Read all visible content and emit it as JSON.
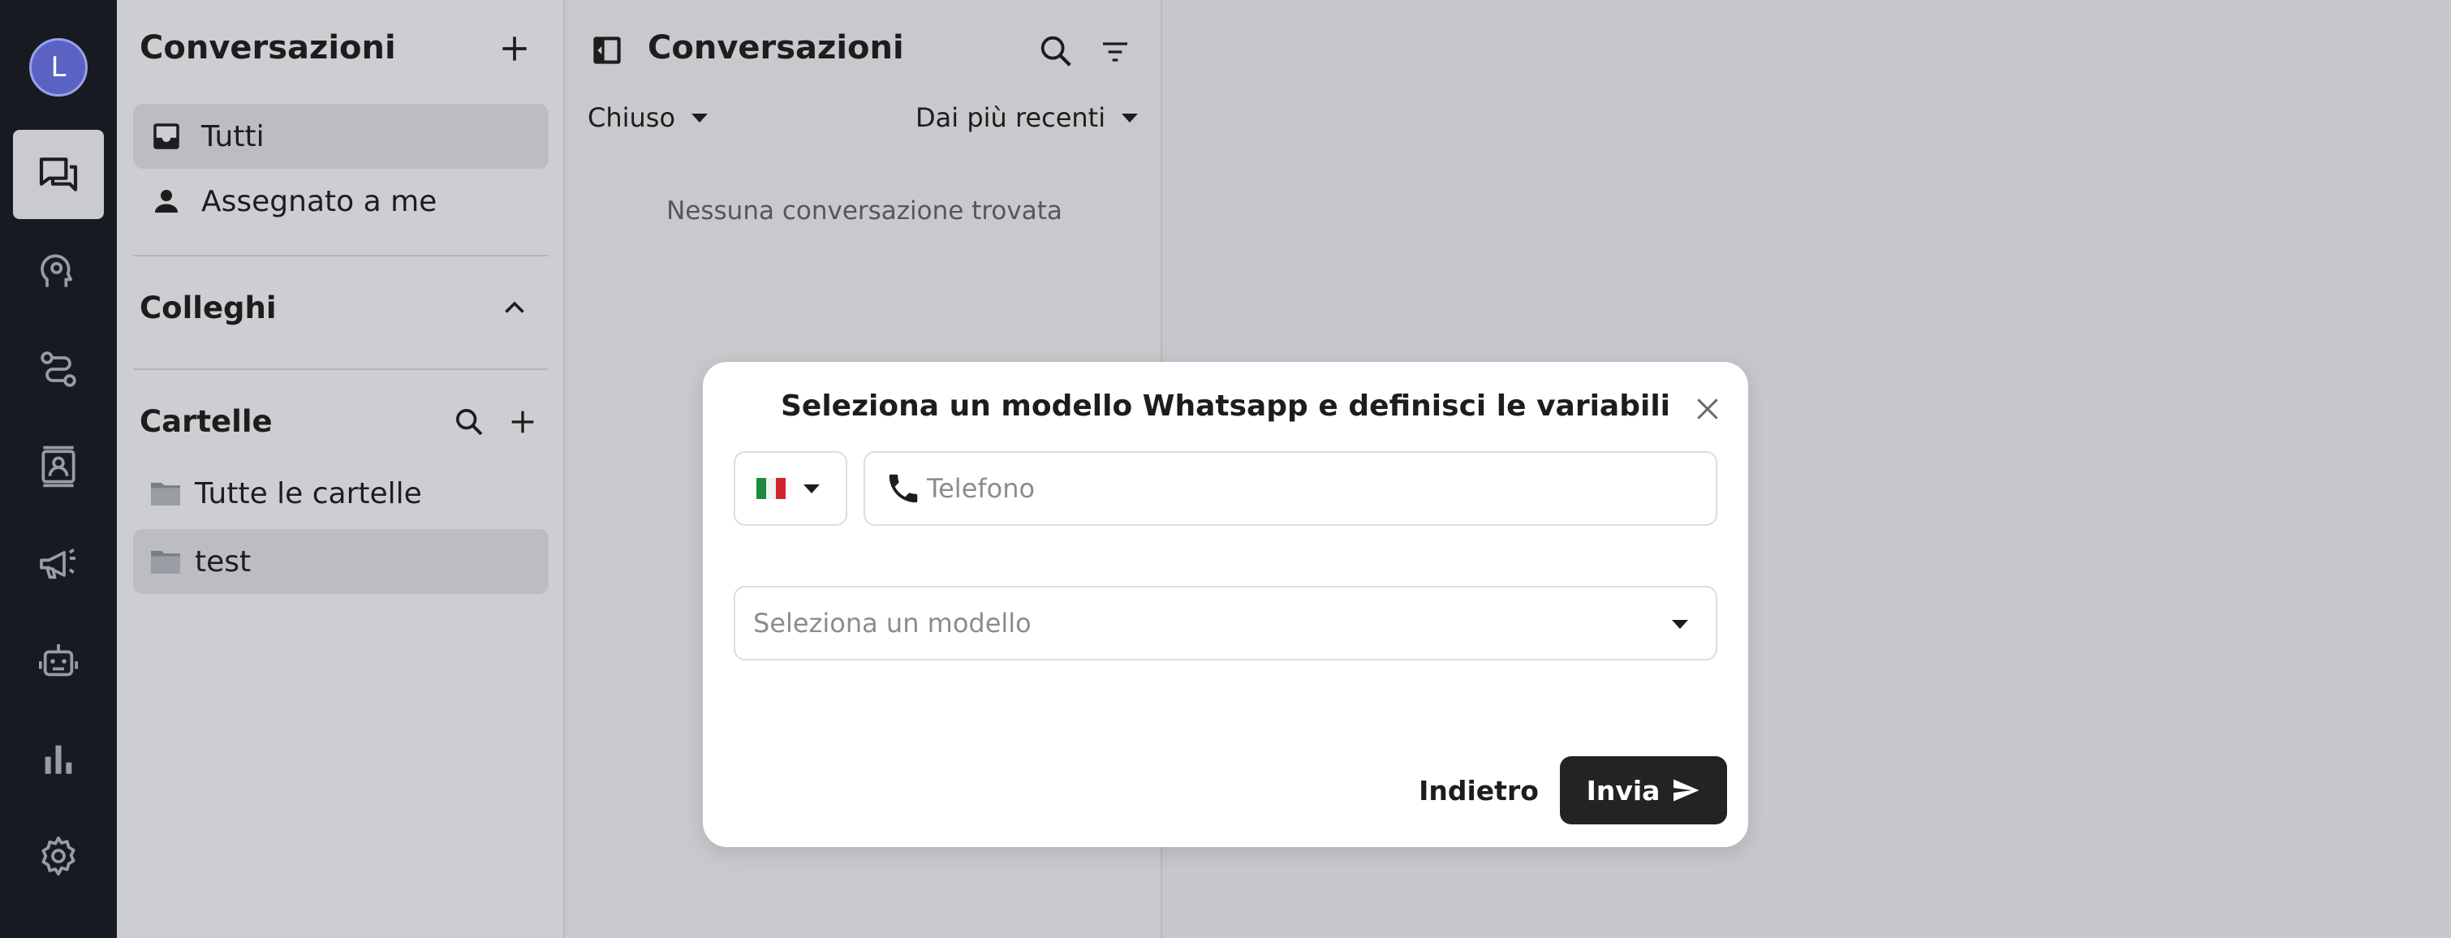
{
  "user": {
    "avatar_initial": "L"
  },
  "rail": {
    "items": [
      {
        "icon": "chat-icon",
        "active": true
      },
      {
        "icon": "brain-settings-icon",
        "active": false
      },
      {
        "icon": "route-icon",
        "active": false
      },
      {
        "icon": "contact-card-icon",
        "active": false
      },
      {
        "icon": "megaphone-icon",
        "active": false
      },
      {
        "icon": "robot-icon",
        "active": false
      },
      {
        "icon": "bar-chart-icon",
        "active": false
      },
      {
        "icon": "gear-icon",
        "active": false
      }
    ]
  },
  "sidebar": {
    "title": "Conversazioni",
    "items": [
      {
        "label": "Tutti",
        "icon": "inbox-icon",
        "selected": true
      },
      {
        "label": "Assegnato a me",
        "icon": "person-icon",
        "selected": false
      }
    ],
    "colleagues_title": "Colleghi",
    "folders_title": "Cartelle",
    "folders": [
      {
        "label": "Tutte le cartelle",
        "icon": "folder-icon",
        "selected": false
      },
      {
        "label": "test",
        "icon": "folder-icon",
        "selected": true
      }
    ]
  },
  "conversations": {
    "title": "Conversazioni",
    "status_filter": "Chiuso",
    "sort": "Dai più recenti",
    "empty_message": "Nessuna conversazione trovata"
  },
  "modal": {
    "title": "Seleziona un modello Whatsapp e definisci le variabili",
    "country_flag": "italy-flag-icon",
    "phone_value": "",
    "phone_placeholder": "Telefono",
    "template_placeholder": "Seleziona un modello",
    "back_label": "Indietro",
    "send_label": "Invia"
  },
  "colors": {
    "rail_bg": "#181a22",
    "avatar": "#5a62c4",
    "primary_button": "#232323",
    "overlay": "#c5c7cb"
  }
}
